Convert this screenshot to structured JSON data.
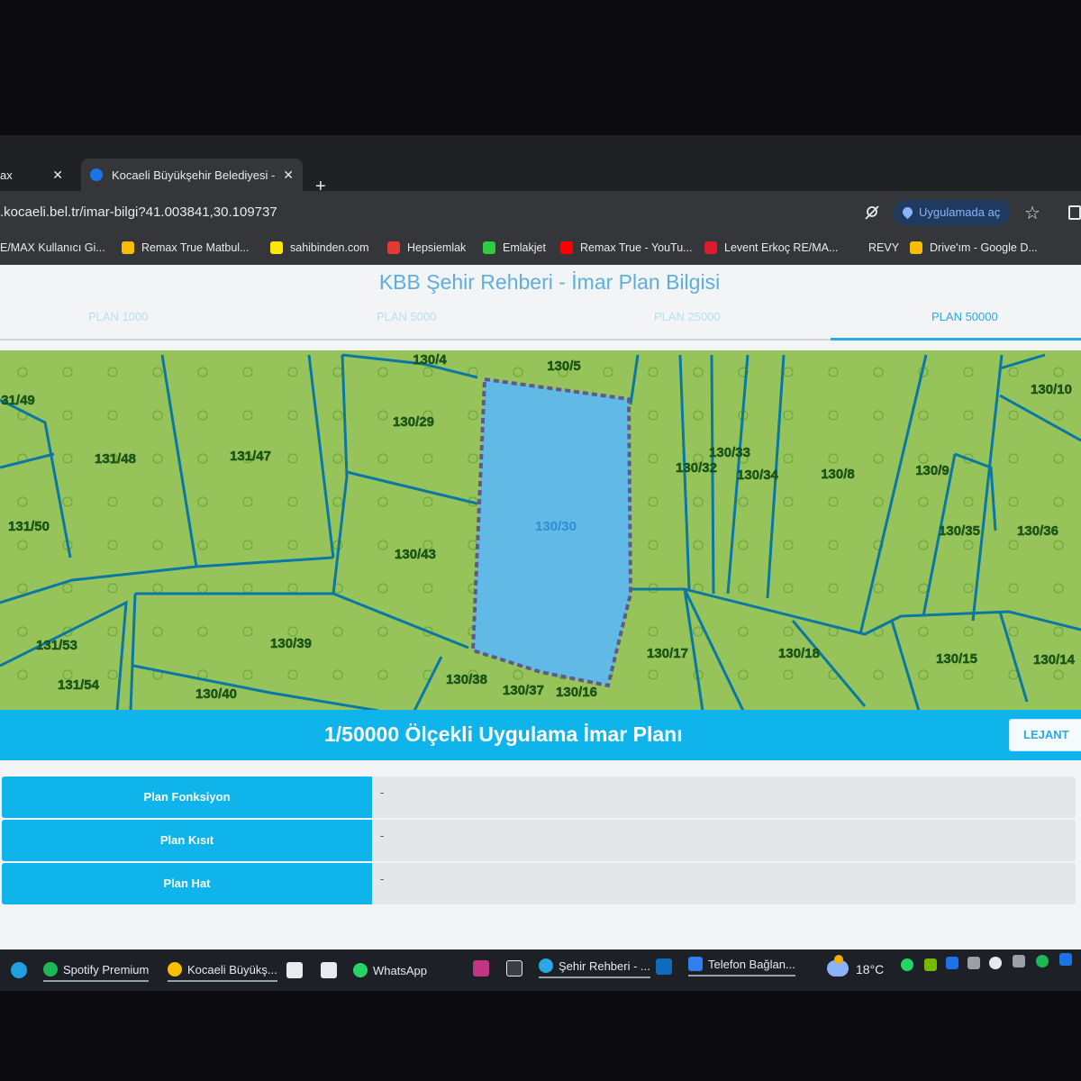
{
  "browser": {
    "tabs": [
      {
        "label": "ax",
        "active": false
      },
      {
        "label": "Kocaeli Büyükşehir Belediyesi -",
        "active": true
      }
    ],
    "new_tab": "+",
    "close_glyph": "✕",
    "url": ".kocaeli.bel.tr/imar-bilgi?41.003841,30.109737",
    "open_in_app": "Uygulamada aç",
    "bookmarks": [
      {
        "label": "E/MAX Kullanıcı Gi...",
        "icon": "none",
        "color": ""
      },
      {
        "label": "Remax True Matbul...",
        "icon": "google-drive-icon",
        "color": "#fbbc04"
      },
      {
        "label": "sahibinden.com",
        "icon": "sahibinden-icon",
        "color": "#ffe800"
      },
      {
        "label": "Hepsiemlak",
        "icon": "hepsiemlak-icon",
        "color": "#e53935"
      },
      {
        "label": "Emlakjet",
        "icon": "emlakjet-icon",
        "color": "#2ecc40"
      },
      {
        "label": "Remax True - YouTu...",
        "icon": "youtube-icon",
        "color": "#ff0000"
      },
      {
        "label": "Levent Erkoç RE/MA...",
        "icon": "remax-icon",
        "color": "#dc1c2e"
      },
      {
        "label": "REVY",
        "icon": "none",
        "color": ""
      },
      {
        "label": "Drive'ım - Google D...",
        "icon": "google-drive-icon",
        "color": "#fbbc04"
      }
    ]
  },
  "page": {
    "title": "KBB Şehir Rehberi - İmar Plan Bilgisi",
    "plan_tabs": [
      "PLAN 1000",
      "PLAN 5000",
      "PLAN 25000",
      "PLAN 50000"
    ],
    "active_plan_tab": "PLAN 50000",
    "map": {
      "colors": {
        "field": "#96c45a",
        "parcel_line": "#0a78a3",
        "highlight": "#61b9e6",
        "label": "#1c5c1a"
      },
      "parcel_labels": [
        "31/49",
        "131/48",
        "131/47",
        "131/50",
        "131/53",
        "131/54",
        "130/39",
        "130/40",
        "130/4",
        "130/5",
        "130/29",
        "130/43",
        "130/38",
        "130/37",
        "130/16",
        "130/32",
        "130/33",
        "130/34",
        "130/8",
        "130/9",
        "130/10",
        "130/35",
        "130/36",
        "130/17",
        "130/18",
        "130/15",
        "130/14"
      ],
      "selected_parcel": "130/30"
    },
    "plan_bar_title": "1/50000 Ölçekli Uygulama İmar Planı",
    "legend_button": "LEJANT",
    "info_rows": [
      {
        "label": "Plan Fonksiyon",
        "value": "-"
      },
      {
        "label": "Plan Kısıt",
        "value": "-"
      },
      {
        "label": "Plan Hat",
        "value": "-"
      }
    ]
  },
  "taskbar": {
    "items": [
      {
        "label": "Spotify Premium",
        "icon": "spotify-icon",
        "color": "#1db954"
      },
      {
        "label": "Kocaeli Büyükş...",
        "icon": "chrome-icon",
        "color": "#fbbc04"
      },
      {
        "label": "WhatsApp",
        "icon": "whatsapp-icon",
        "color": "#25d366"
      },
      {
        "label": "Şehir Rehberi - ...",
        "icon": "edge-icon",
        "color": "#29a9e6"
      },
      {
        "label": "Telefon Bağlan...",
        "icon": "phone-link-icon",
        "color": "#2f80ed"
      }
    ],
    "temperature": "18°C"
  }
}
